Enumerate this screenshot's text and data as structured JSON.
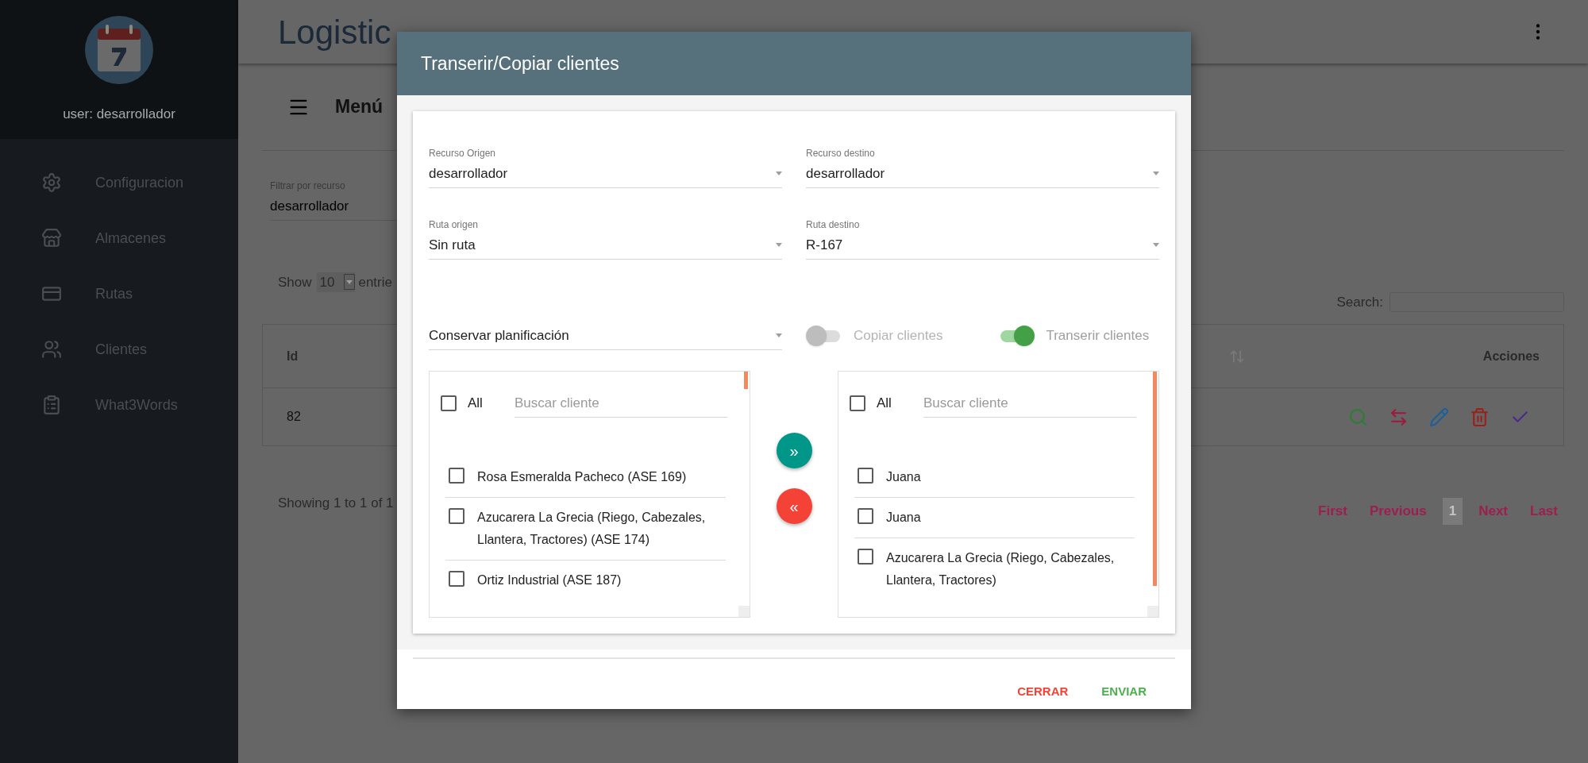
{
  "sidebar": {
    "user": "user: desarrollador",
    "items": [
      {
        "label": "Configuracion"
      },
      {
        "label": "Almacenes"
      },
      {
        "label": "Rutas"
      },
      {
        "label": "Clientes"
      },
      {
        "label": "What3Words"
      }
    ]
  },
  "app_bar": {
    "title": "Logistic"
  },
  "page": {
    "menu_title": "Menú",
    "filter": {
      "label": "Filtrar por recurso",
      "value": "desarrollador"
    },
    "length": {
      "prefix": "Show",
      "value": "10",
      "suffix": "entrie"
    },
    "search_label": "Search:",
    "table": {
      "columns": [
        "Id",
        "Acciones"
      ],
      "rows": [
        {
          "id": "82"
        }
      ]
    },
    "info": "Showing 1 to 1 of 1",
    "pagination": [
      {
        "label": "First",
        "selected": false
      },
      {
        "label": "Previous",
        "selected": false
      },
      {
        "label": "1",
        "selected": true
      },
      {
        "label": "Next",
        "selected": false
      },
      {
        "label": "Last",
        "selected": false
      }
    ]
  },
  "dialog": {
    "title": "Transerir/Copiar clientes",
    "fields": [
      {
        "label": "Recurso Origen",
        "value": "desarrollador"
      },
      {
        "label": "Recurso destino",
        "value": "desarrollador"
      },
      {
        "label": "Ruta origen",
        "value": "Sin ruta"
      },
      {
        "label": "Ruta destino",
        "value": "R-167"
      }
    ],
    "plan_select": {
      "value": "Conservar planificación"
    },
    "toggles": [
      {
        "label": "Copiar clientes",
        "on": false
      },
      {
        "label": "Transerir clientes",
        "on": true
      }
    ],
    "lists": [
      {
        "all": {
          "label": "All",
          "checked": false
        },
        "search": {
          "placeholder": "Buscar cliente"
        },
        "items": [
          {
            "label": "Rosa Esmeralda Pacheco (ASE 169)",
            "checked": false
          },
          {
            "label": "Azucarera La Grecia (Riego, Cabezales, Llantera, Tractores) (ASE 174)",
            "checked": false
          },
          {
            "label": "Ortiz Industrial (ASE 187)",
            "checked": false
          }
        ]
      },
      {
        "all": {
          "label": "All",
          "checked": false
        },
        "search": {
          "placeholder": "Buscar cliente"
        },
        "items": [
          {
            "label": "Juana",
            "checked": false
          },
          {
            "label": "Juana",
            "checked": false
          },
          {
            "label": "Azucarera La Grecia (Riego, Cabezales, Llantera, Tractores)",
            "checked": false
          }
        ]
      }
    ],
    "move_buttons": [
      {
        "label": "»",
        "kind": "add"
      },
      {
        "label": "«",
        "kind": "remove"
      }
    ],
    "actions": [
      {
        "label": "CERRAR",
        "kind": "cancel"
      },
      {
        "label": "ENVIAR",
        "kind": "submit"
      }
    ]
  }
}
